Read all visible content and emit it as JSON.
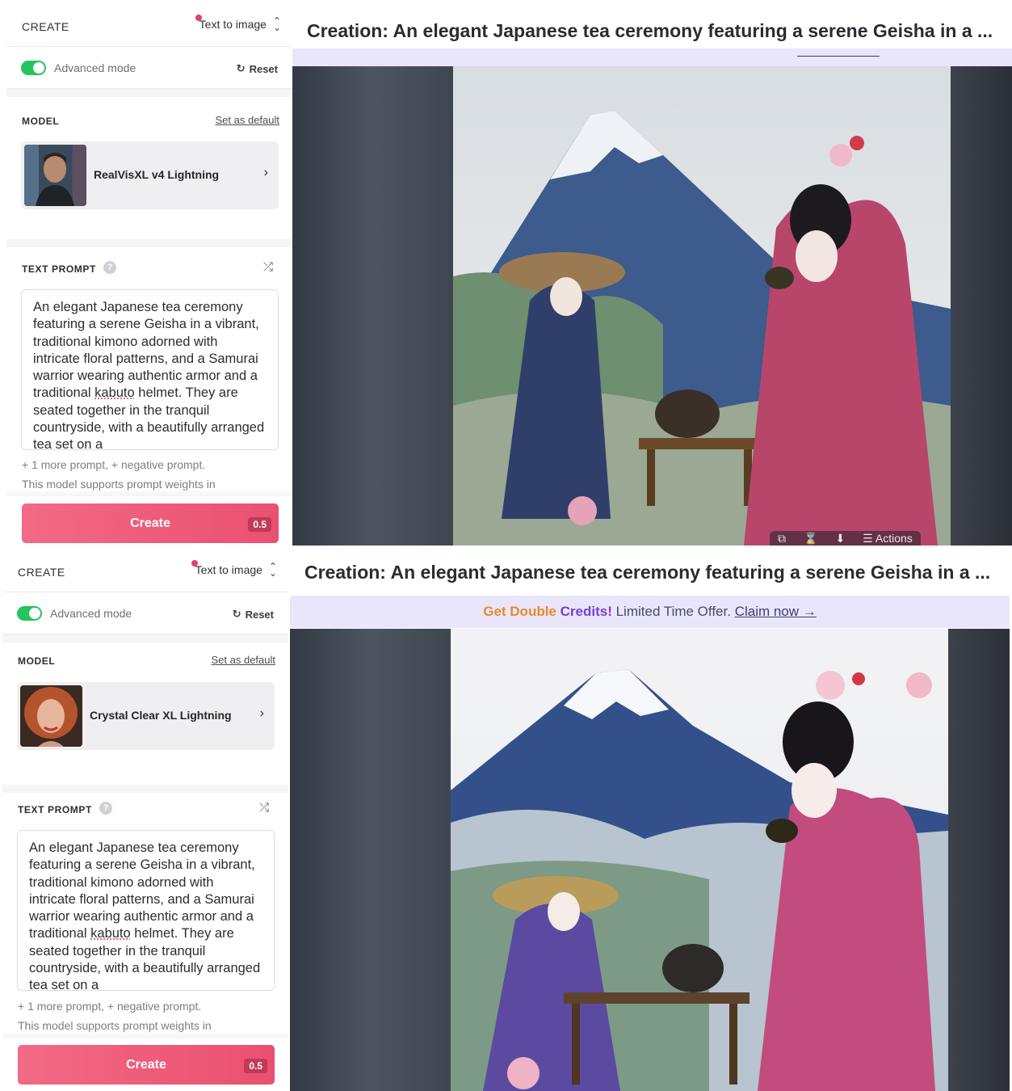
{
  "panels": [
    {
      "sidebar": {
        "create_label": "CREATE",
        "mode_select": "Text to image",
        "advanced_mode_label": "Advanced mode",
        "advanced_mode_on": true,
        "reset_label": "Reset",
        "model_section": "MODEL",
        "set_default_label": "Set as default",
        "model_name": "RealVisXL v4 Lightning",
        "prompt_section": "TEXT PROMPT",
        "prompt_text_before": "An elegant Japanese tea ceremony featuring a serene Geisha in a vibrant, traditional kimono adorned with intricate floral patterns, and a Samurai warrior wearing authentic armor and a traditional ",
        "prompt_misspelt": "kabuto",
        "prompt_text_after": " helmet. They are seated together in the tranquil countryside, with a beautifully arranged tea set on a",
        "prompt_extra": "+ 1 more prompt, + negative prompt.",
        "prompt_weights": "This model supports prompt weights in",
        "create_label_btn": "Create",
        "create_cost": "0.5"
      },
      "main": {
        "title": "Creation: An elegant Japanese tea ceremony featuring a serene Geisha in a ...",
        "action_label": "Actions"
      }
    },
    {
      "sidebar": {
        "create_label": "CREATE",
        "mode_select": "Text to image",
        "advanced_mode_label": "Advanced mode",
        "advanced_mode_on": true,
        "reset_label": "Reset",
        "model_section": "MODEL",
        "set_default_label": "Set as default",
        "model_name": "Crystal Clear XL Lightning",
        "prompt_section": "TEXT PROMPT",
        "prompt_text_before": "An elegant Japanese tea ceremony featuring a serene Geisha in a vibrant, traditional kimono adorned with intricate floral patterns, and a Samurai warrior wearing authentic armor and a traditional ",
        "prompt_misspelt": "kabuto",
        "prompt_text_after": " helmet. They are seated together in the tranquil countryside, with a beautifully arranged tea set on a",
        "prompt_extra": "+ 1 more prompt, + negative prompt.",
        "prompt_weights": "This model supports prompt weights in",
        "create_label_btn": "Create",
        "create_cost": "0.5"
      },
      "main": {
        "title": "Creation: An elegant Japanese tea ceremony featuring a serene Geisha in a ...",
        "promo_highlight_1": "Get Double",
        "promo_highlight_2": "Credits!",
        "promo_text": "Limited Time Offer.",
        "promo_link": "Claim now →"
      }
    }
  ],
  "icons": {
    "reset": "refresh-icon",
    "chevron_updown": "chevron-updown-icon",
    "chevron_right": "chevron-right-icon",
    "help": "help-icon",
    "shuffle": "shuffle-icon",
    "actions": "list-icon"
  },
  "colors": {
    "accent": "#ea5070",
    "toggle_on": "#22c55e",
    "promo_bg": "#e9e6fb"
  }
}
